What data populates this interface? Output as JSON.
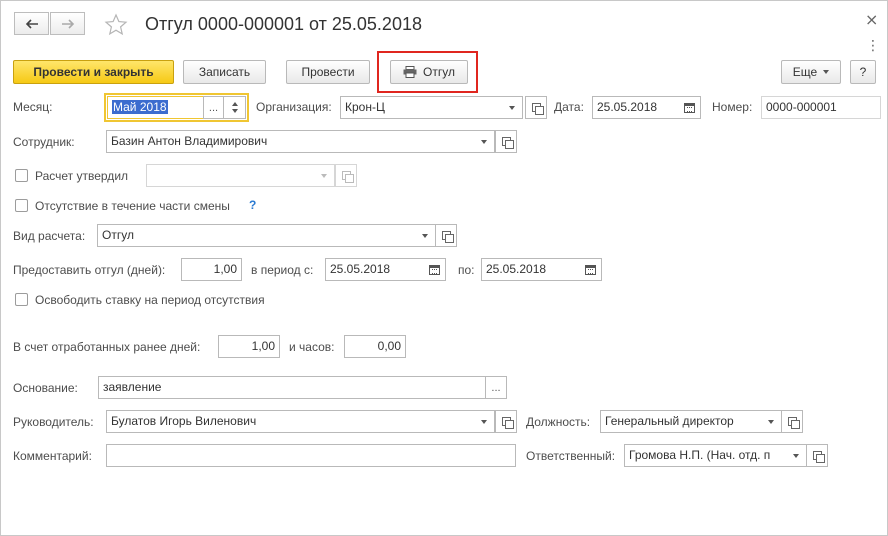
{
  "window": {
    "title": "Отгул 0000-000001 от 25.05.2018",
    "close_glyph": "×",
    "more_glyph": "⋮"
  },
  "toolbar": {
    "post_and_close": "Провести и закрыть",
    "save": "Записать",
    "post": "Провести",
    "print": "Отгул",
    "more": "Еще",
    "help": "?"
  },
  "form": {
    "month_label": "Месяц:",
    "month_value": "Май 2018",
    "month_picker": "...",
    "org_label": "Организация:",
    "org_value": "Крон-Ц",
    "date_label": "Дата:",
    "date_value": "25.05.2018",
    "number_label": "Номер:",
    "number_value": "0000-000001",
    "employee_label": "Сотрудник:",
    "employee_value": "Базин Антон Владимирович",
    "approved_label": "Расчет утвердил",
    "partial_shift_label": "Отсутствие в течение части смены",
    "partial_shift_help": "?",
    "calc_type_label": "Вид расчета:",
    "calc_type_value": "Отгул",
    "days_label": "Предоставить отгул (дней):",
    "days_value": "1,00",
    "period_from_label": "в период с:",
    "period_from_value": "25.05.2018",
    "period_to_label": "по:",
    "period_to_value": "25.05.2018",
    "release_rate_label": "Освободить ставку на период отсутствия",
    "worked_days_label": "В счет отработанных ранее дней:",
    "worked_days_value": "1,00",
    "hours_label": "и часов:",
    "hours_value": "0,00",
    "basis_label": "Основание:",
    "basis_value": "заявление",
    "basis_picker": "...",
    "manager_label": "Руководитель:",
    "manager_value": "Булатов Игорь Виленович",
    "position_label": "Должность:",
    "position_value": "Генеральный директор",
    "comment_label": "Комментарий:",
    "comment_value": "",
    "responsible_label": "Ответственный:",
    "responsible_value": "Громова Н.П. (Нач. отд. п"
  },
  "colors": {
    "primary_button": "#f6c915",
    "highlight_frame": "#e0261f",
    "focus_border": "#f0c632",
    "selection": "#3c6ccf",
    "help_icon": "#2a7ad2"
  }
}
